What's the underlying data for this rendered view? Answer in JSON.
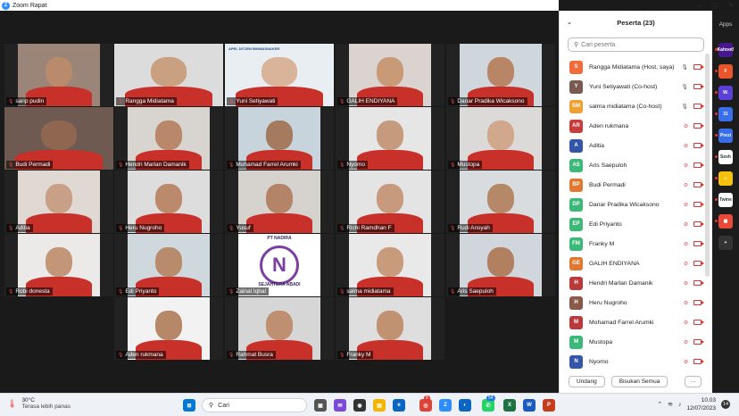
{
  "window": {
    "title": "Zoom Rapat",
    "logo": "Z"
  },
  "window_controls": {
    "minimize": "—",
    "maximize": "☐",
    "close": "✕"
  },
  "gallery": [
    {
      "name": "sarip pudin",
      "skin": "#b98a6c",
      "bg": "#9a8578"
    },
    {
      "name": "Rangga Midiatama",
      "skin": "#c9a080",
      "bg": "#dcdcdc",
      "active": true
    },
    {
      "name": "Yuni Setiyawati",
      "skin": "#d9b49a",
      "bg": "#e8eef2",
      "banner": "APEL DITJEN BINWASNAKER"
    },
    {
      "name": "GALIH ENDIYANA",
      "skin": "#c89a78",
      "bg": "#dad3cf"
    },
    {
      "name": "Danar Pradika Wicaksono",
      "skin": "#b88566",
      "bg": "#cfd6dc"
    },
    {
      "name": "Budi Permadi",
      "skin": "#8f6650",
      "bg": "#6e5a50"
    },
    {
      "name": "Hendri Marlan Damanik",
      "skin": "#b9876a",
      "bg": "#d8d4d0"
    },
    {
      "name": "Mohamad Farrel Arumki",
      "skin": "#a57b60",
      "bg": "#c8d4dc"
    },
    {
      "name": "Nyomo",
      "skin": "#c69a7c",
      "bg": "#e6e6e6"
    },
    {
      "name": "Mustopa",
      "skin": "#d2a88c",
      "bg": "#dcdad8"
    },
    {
      "name": "Aditia",
      "skin": "#c8a088",
      "bg": "#e0d8d2"
    },
    {
      "name": "Heru Nugroho",
      "skin": "#bb8a6c",
      "bg": "#dddddd"
    },
    {
      "name": "Yusuf",
      "skin": "#b48468",
      "bg": "#d6d2ce"
    },
    {
      "name": "Richi Ramdhan F",
      "skin": "#c79a7e",
      "bg": "#e4e4e4"
    },
    {
      "name": "Rudi Ansyah",
      "skin": "#b58868",
      "bg": "#d8dcdf"
    },
    {
      "name": "Robi donesta",
      "skin": "#c29676",
      "bg": "#eceae8"
    },
    {
      "name": "Edi Priyanto",
      "skin": "#b98b6d",
      "bg": "#cfd8dc"
    },
    {
      "name": "Zainal Iqbal",
      "skin": "#ffffff",
      "bg": "#ffffff",
      "logo": {
        "line1": "PT NADIRA",
        "line2": "SEJAHTERA ABADI",
        "mark": "N"
      }
    },
    {
      "name": "salma midiatama",
      "skin": "#c99b7d",
      "bg": "#e9e9e9"
    },
    {
      "name": "Aris Saepuloh",
      "skin": "#b08060",
      "bg": "#d0d6dc"
    },
    {
      "name": "Aden rukmana",
      "skin": "#b78867",
      "bg": "#f2f2f2"
    },
    {
      "name": "Rahmat Busra",
      "skin": "#be8f70",
      "bg": "#d6d6d6"
    },
    {
      "name": "Franky M",
      "skin": "#c09272",
      "bg": "#dedede"
    }
  ],
  "participants_panel": {
    "title": "Peserta (23)",
    "search_placeholder": "Cari peserta",
    "items": [
      {
        "initials": "S",
        "color": "#f26b3a",
        "name": "Rangga Midiatama (Host, saya)",
        "mic": true
      },
      {
        "initials": "Y",
        "color": "#7a5a50",
        "name": "Yuni Setiyawati (Co-host)",
        "mic": true
      },
      {
        "initials": "SM",
        "color": "#f0a030",
        "name": "salma midiatama (Co-host)",
        "mic": true
      },
      {
        "initials": "AR",
        "color": "#c83c3c",
        "name": "Aden rukmana",
        "mic": false
      },
      {
        "initials": "A",
        "color": "#3456a8",
        "name": "Aditia",
        "mic": false
      },
      {
        "initials": "AS",
        "color": "#3cb878",
        "name": "Aris Saepuloh",
        "mic": false
      },
      {
        "initials": "BP",
        "color": "#e07830",
        "name": "Budi Permadi",
        "mic": false
      },
      {
        "initials": "DP",
        "color": "#3cb878",
        "name": "Danar Pradika Wicaksono",
        "mic": false
      },
      {
        "initials": "EP",
        "color": "#3cb878",
        "name": "Edi Priyanto",
        "mic": false
      },
      {
        "initials": "FM",
        "color": "#3cb878",
        "name": "Franky M",
        "mic": false
      },
      {
        "initials": "GE",
        "color": "#e07830",
        "name": "GALIH ENDIYANA",
        "mic": false
      },
      {
        "initials": "H",
        "color": "#b83a3a",
        "name": "Hendri Marlan Damanik",
        "mic": false
      },
      {
        "initials": "H",
        "color": "#8a5a48",
        "name": "Heru Nugroho",
        "mic": false
      },
      {
        "initials": "M",
        "color": "#b83a3a",
        "name": "Mohamad Farrel Arumki",
        "mic": false
      },
      {
        "initials": "M",
        "color": "#3cb878",
        "name": "Mustopa",
        "mic": false
      },
      {
        "initials": "N",
        "color": "#3456a8",
        "name": "Nyomo",
        "mic": false
      }
    ],
    "invite_label": "Undang",
    "mute_all_label": "Bisukan Semua",
    "more_label": "···"
  },
  "apps_sidebar": {
    "label": "Apps",
    "icons": [
      {
        "name": "kahoot-icon",
        "text": "Kahoot!",
        "color": "#46178f"
      },
      {
        "name": "app-f-icon",
        "text": "F",
        "color": "#e8552b"
      },
      {
        "name": "wordwall-icon",
        "text": "W.",
        "color": "#5a3fd8"
      },
      {
        "name": "app-calendar-icon",
        "text": "31",
        "color": "#3a6ee8"
      },
      {
        "name": "prezi-icon",
        "text": "Prezi",
        "color": "#3a6ee8"
      },
      {
        "name": "sesh-icon",
        "text": "Sesh",
        "color": "#ffffff"
      },
      {
        "name": "app-smile-icon",
        "text": "☺",
        "color": "#f4c20d"
      },
      {
        "name": "twine-icon",
        "text": "Twine",
        "color": "#ffffff"
      },
      {
        "name": "app-grid-icon",
        "text": "▦",
        "color": "#e84a3a"
      },
      {
        "name": "add-app-icon",
        "text": "+",
        "color": "#333333"
      }
    ]
  },
  "taskbar": {
    "weather_temp": "30°C",
    "weather_desc": "Terasa lebih panas",
    "search_label": "Cari",
    "time": "10.03",
    "date": "12/07/2023",
    "notification_count": "14",
    "badge_chrome": "8",
    "badge_wa": "54"
  }
}
